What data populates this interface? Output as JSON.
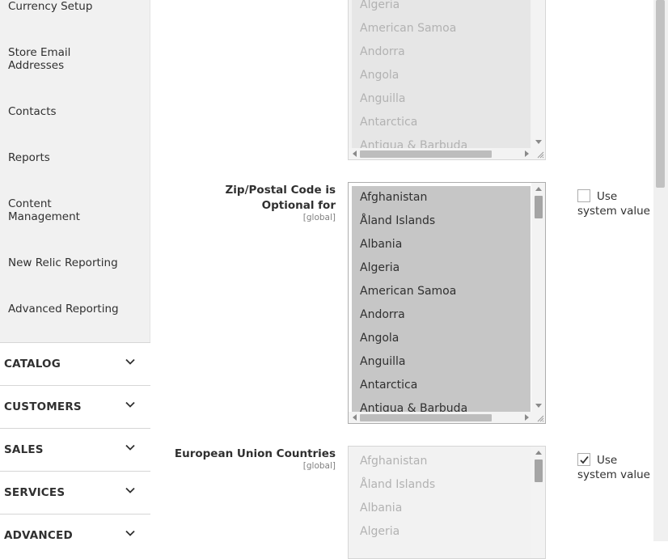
{
  "sidebar": {
    "links": [
      {
        "label": "Currency Setup"
      },
      {
        "label": "Store Email Addresses"
      },
      {
        "label": "Contacts"
      },
      {
        "label": "Reports"
      },
      {
        "label": "Content Management"
      },
      {
        "label": "New Relic Reporting"
      },
      {
        "label": "Advanced Reporting"
      }
    ],
    "sections": [
      {
        "label": "CATALOG"
      },
      {
        "label": "CUSTOMERS"
      },
      {
        "label": "SALES"
      },
      {
        "label": "SERVICES"
      },
      {
        "label": "ADVANCED"
      }
    ]
  },
  "fields": {
    "top_list": {
      "options": [
        "Algeria",
        "American Samoa",
        "Andorra",
        "Angola",
        "Anguilla",
        "Antarctica",
        "Antigua & Barbuda"
      ]
    },
    "zip_optional": {
      "label": "Zip/Postal Code is Optional for",
      "scope": "[global]",
      "options": [
        "Afghanistan",
        "Åland Islands",
        "Albania",
        "Algeria",
        "American Samoa",
        "Andorra",
        "Angola",
        "Anguilla",
        "Antarctica",
        "Antigua & Barbuda"
      ],
      "use_system_value": {
        "label": "Use system value",
        "checked": false
      }
    },
    "eu_countries": {
      "label": "European Union Countries",
      "scope": "[global]",
      "options": [
        "Afghanistan",
        "Åland Islands",
        "Albania",
        "Algeria"
      ],
      "use_system_value": {
        "label": "Use system value",
        "checked": true
      }
    }
  }
}
